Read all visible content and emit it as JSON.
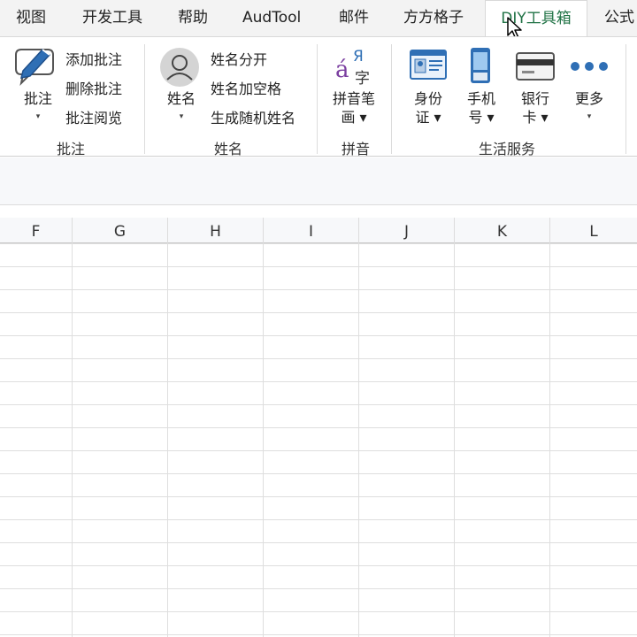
{
  "tabs": [
    {
      "label": "视图",
      "active": false
    },
    {
      "label": "开发工具",
      "active": false
    },
    {
      "label": "帮助",
      "active": false
    },
    {
      "label": "AudTool",
      "active": false
    },
    {
      "label": "邮件",
      "active": false
    },
    {
      "label": "方方格子",
      "active": false
    },
    {
      "label": "DIY工具箱",
      "active": true
    },
    {
      "label": "公式",
      "active": false
    }
  ],
  "ribbon": {
    "comment_group": {
      "big_button": {
        "line1": "批注",
        "line2": "▾",
        "icon": "pen-speech-bubble-icon"
      },
      "items": [
        "添加批注",
        "删除批注",
        "批注阅览"
      ],
      "label": "批注"
    },
    "name_group": {
      "big_button": {
        "line1": "姓名",
        "line2": "▾",
        "icon": "person-avatar-icon"
      },
      "items": [
        "姓名分开",
        "姓名加空格",
        "生成随机姓名"
      ],
      "label": "姓名"
    },
    "pinyin_group": {
      "big_button": {
        "line1": "拼音笔",
        "line2": "画 ▾",
        "icon": "pinyin-icon",
        "icon_text_a": "á",
        "icon_text_b": "Я",
        "icon_text_c": "字"
      },
      "label": "拼音"
    },
    "life_group": {
      "buttons": [
        {
          "line1": "身份",
          "line2": "证 ▾",
          "icon": "id-card-icon"
        },
        {
          "line1": "手机",
          "line2": "号 ▾",
          "icon": "mobile-phone-icon"
        },
        {
          "line1": "银行",
          "line2": "卡 ▾",
          "icon": "bank-card-icon"
        },
        {
          "line1": "更多",
          "line2": "▾",
          "icon": "more-dots-icon"
        }
      ],
      "label": "生活服务"
    }
  },
  "columns": [
    "F",
    "G",
    "H",
    "I",
    "J",
    "K",
    "L"
  ],
  "colors": {
    "accent": "#217346",
    "icon_blue": "#2f6fb5"
  }
}
